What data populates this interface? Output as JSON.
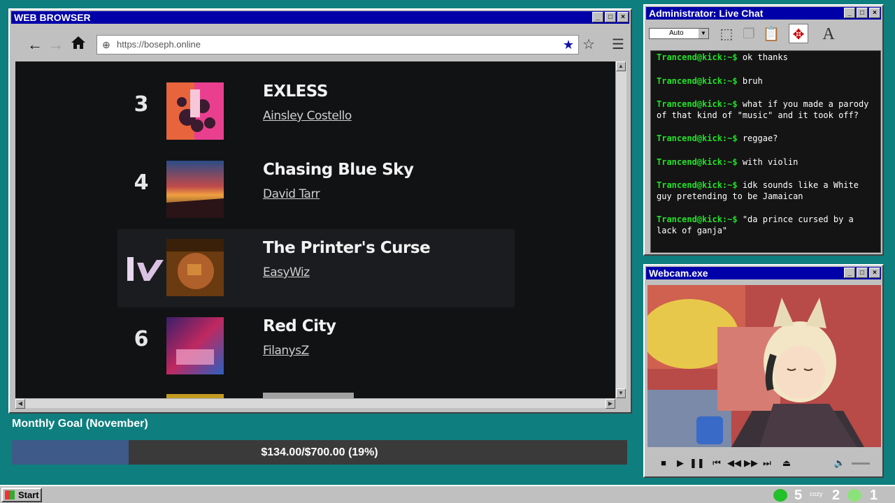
{
  "browser": {
    "title": "WEB BROWSER",
    "url": "https://boseph.online",
    "songs": [
      {
        "rank": "3",
        "title": "EXLESS",
        "artist": "Ainsley Costello"
      },
      {
        "rank": "4",
        "title": "Chasing Blue Sky",
        "artist": "David Tarr"
      },
      {
        "rank": "",
        "title": "The Printer's Curse",
        "artist": "EasyWiz"
      },
      {
        "rank": "6",
        "title": "Red City",
        "artist": "FilanysZ"
      }
    ]
  },
  "goal": {
    "label": "Monthly Goal (November)",
    "text": "$134.00/$700.00 (19%)",
    "progress": 0.19,
    "fill_color": "#3d5a88"
  },
  "chat": {
    "title": "Administrator: Live Chat",
    "font_size": "Auto",
    "messages": [
      {
        "user": "Trancend@kick:~$",
        "text": "ok thanks"
      },
      {
        "user": "Trancend@kick:~$",
        "text": "bruh"
      },
      {
        "user": "Trancend@kick:~$",
        "text": "what if you made a parody of that kind of \"music\" and it took off?"
      },
      {
        "user": "Trancend@kick:~$",
        "text": "reggae?"
      },
      {
        "user": "Trancend@kick:~$",
        "text": "with violin"
      },
      {
        "user": "Trancend@kick:~$",
        "text": "idk sounds like a White guy pretending to be Jamaican"
      },
      {
        "user": "Trancend@kick:~$",
        "text": "\"da prince cursed by a lack of ganja\""
      }
    ],
    "user_color": "#22e028"
  },
  "webcam": {
    "title": "Webcam.exe"
  },
  "taskbar": {
    "start_label": "Start",
    "kick_count": "5",
    "cozy_label": "cozy",
    "cozy_count": "2",
    "play_count": "1"
  }
}
